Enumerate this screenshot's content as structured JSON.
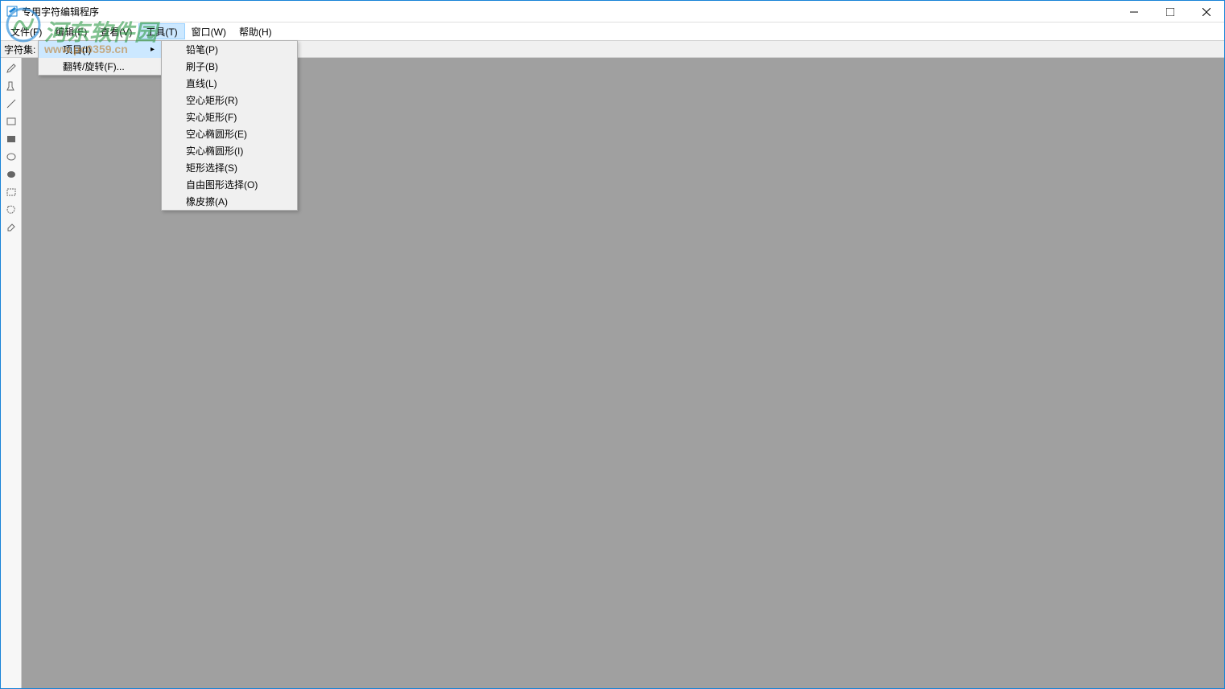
{
  "title": "专用字符编辑程序",
  "menubar": {
    "file": "文件(F)",
    "edit": "编辑(E)",
    "view": "查看(V)",
    "tools": "工具(T)",
    "window": "窗口(W)",
    "help": "帮助(H)"
  },
  "toolbar": {
    "charset_label": "字符集:"
  },
  "tools_menu": {
    "item": "项目(I)",
    "flip_rotate": "翻转/旋转(F)..."
  },
  "tools_submenu": {
    "pencil": "铅笔(P)",
    "brush": "刷子(B)",
    "line": "直线(L)",
    "hollow_rect": "空心矩形(R)",
    "solid_rect": "实心矩形(F)",
    "hollow_ellipse": "空心椭圆形(E)",
    "solid_ellipse": "实心椭圆形(I)",
    "rect_select": "矩形选择(S)",
    "freeform_select": "自由图形选择(O)",
    "eraser": "橡皮擦(A)"
  },
  "watermark": {
    "text": "河东软件园",
    "url": "www.pc0359.cn"
  }
}
